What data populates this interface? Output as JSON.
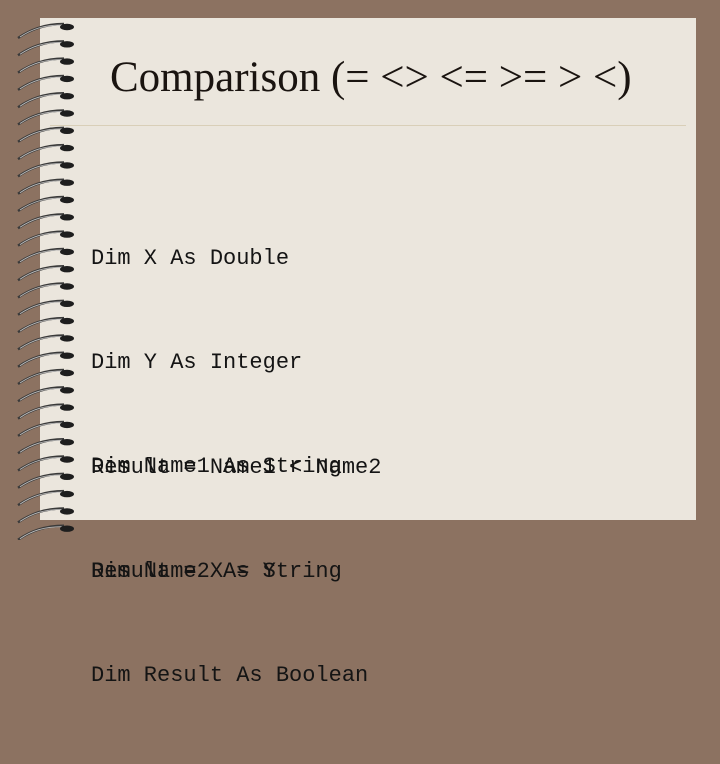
{
  "slide": {
    "title": "Comparison (= <> <= >= > <)",
    "declarations": [
      "Dim X As Double",
      "Dim Y As Integer",
      "Dim Name1 As String",
      "Dim Name2 As String",
      "Dim Result As Boolean"
    ],
    "statements": [
      "Result = Name1 < Name2",
      "Result = X = Y"
    ]
  },
  "colors": {
    "background": "#8c7261",
    "page": "#ebe6dd",
    "text": "#141414"
  },
  "icons": [
    "spiral-binding-icon"
  ]
}
